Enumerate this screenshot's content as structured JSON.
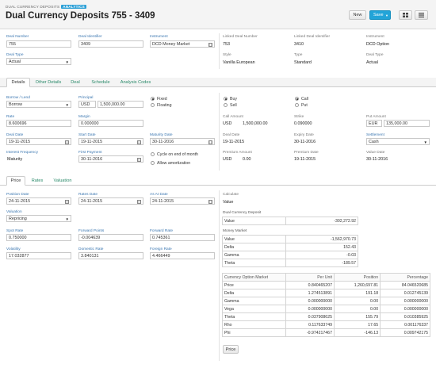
{
  "header": {
    "breadcrumb": "DUAL CURRENCY DEPOSITS",
    "badge": "ANALYTICS",
    "title": "Dual Currency Deposits 755 - 3409",
    "new_label": "New",
    "save_label": "Save"
  },
  "top": {
    "deal_number_label": "Deal Number",
    "deal_number": "755",
    "deal_identifier_label": "Deal Identifier",
    "deal_identifier": "3409",
    "instrument_label": "Instrument",
    "instrument": "DCD Money Market",
    "deal_type_label": "Deal Type",
    "deal_type": "Actual",
    "linked_deal_number_label": "Linked Deal Number",
    "linked_deal_number": "753",
    "linked_deal_identifier_label": "Linked Deal Identifier",
    "linked_deal_identifier": "3410",
    "linked_instrument_label": "Instrument",
    "linked_instrument": "DCD Option",
    "style_label": "Style",
    "style": "Vanilla European",
    "type_label": "Type",
    "type": "Standard",
    "linked_deal_type_label": "Deal Type",
    "linked_deal_type": "Actual"
  },
  "tabs": [
    "Details",
    "Other Details",
    "Deal",
    "Schedule",
    "Analysis Codes"
  ],
  "details": {
    "borrow_lend_label": "Borrow / Lend",
    "borrow_lend": "Borrow",
    "principal_label": "Principal",
    "principal_ccy": "USD",
    "principal": "1,500,000.00",
    "fixed_label": "Fixed",
    "floating_label": "Floating",
    "rate_label": "Rate",
    "rate": "8.600696",
    "margin_label": "Margin",
    "margin": "0.000000",
    "deal_date_label": "Deal Date",
    "deal_date": "19-11-2015",
    "start_date_label": "Start Date",
    "start_date": "19-11-2015",
    "maturity_date_label": "Maturity Date",
    "maturity_date": "30-11-2016",
    "interest_freq_label": "Interest Frequency",
    "interest_freq": "Maturity",
    "first_payment_label": "First Payment",
    "first_payment": "30-11-2016",
    "cycle_label": "Cycle on end of month",
    "amort_label": "Allow amortization",
    "buy_label": "Buy",
    "sell_label": "Sell",
    "call_label": "Call",
    "put_label": "Put",
    "call_amount_label": "Call Amount",
    "call_amount_ccy": "USD",
    "call_amount": "1,500,000.00",
    "strike_label": "Strike",
    "strike": "0.090000",
    "put_amount_label": "Put Amount",
    "put_amount_ccy": "EUR",
    "put_amount": "135,000.00",
    "opt_deal_date_label": "Deal Date",
    "opt_deal_date": "19-11-2015",
    "expiry_date_label": "Expiry Date",
    "expiry_date": "30-11-2016",
    "settlement_label": "Settlement",
    "settlement": "Cash",
    "premium_amount_label": "Premium Amount",
    "premium_ccy": "USD",
    "premium_amount": "0.00",
    "premium_date_label": "Premium Date",
    "premium_date": "19-11-2015",
    "value_date_label": "Value Date",
    "value_date": "30-11-2016"
  },
  "subtabs": [
    "Price",
    "Rates",
    "Valuation"
  ],
  "price": {
    "position_date_label": "Position Date",
    "position_date": "24-11-2015",
    "rates_date_label": "Rates Date",
    "rates_date": "24-11-2015",
    "as_at_date_label": "As At Date",
    "as_at_date": "24-11-2015",
    "valuation_label": "Valuation",
    "valuation": "Repricing",
    "spot_rate_label": "Spot Rate",
    "spot_rate": "0.750000",
    "forward_points_label": "Forward Points",
    "forward_points": "-0.004639",
    "forward_rate_label": "Forward Rate",
    "forward_rate": "0.745361",
    "volatility_label": "Volatility",
    "volatility": "17.032877",
    "domestic_rate_label": "Domestic Rate",
    "domestic_rate": "3.840131",
    "foreign_rate_label": "Foreign Rate",
    "foreign_rate": "4.466449",
    "calculate_label": "Calculate",
    "calculate": "Value",
    "price_button": "Price"
  },
  "dcd_table": {
    "title": "Dual Currency Deposit",
    "rows": [
      [
        "Value",
        "-302,272.92"
      ]
    ]
  },
  "mm_table": {
    "title": "Money Market",
    "rows": [
      [
        "Value",
        "-1,562,970.73"
      ],
      [
        "Delta",
        "152.43"
      ],
      [
        "Gamma",
        "-0.03"
      ],
      [
        "Theta",
        "-189.57"
      ]
    ]
  },
  "com_table": {
    "headers": [
      "Currency Option Market",
      "Per Unit",
      "Position",
      "Percentage"
    ],
    "rows": [
      [
        "Price",
        "0.840465207",
        "1,260,697.81",
        "84.046520685"
      ],
      [
        "Delta",
        "1.274513891",
        "191.18",
        "0.012745139"
      ],
      [
        "Gamma",
        "0.000000000",
        "0.00",
        "0.000000000"
      ],
      [
        "Vega",
        "0.000000000",
        "0.00",
        "0.000000000"
      ],
      [
        "Theta",
        "0.037908625",
        "155.79",
        "0.010385925"
      ],
      [
        "Rho",
        "0.117633749",
        "17.65",
        "0.001176337"
      ],
      [
        "Phi",
        "-0.974217467",
        "-146.13",
        "0.009742175"
      ]
    ]
  }
}
